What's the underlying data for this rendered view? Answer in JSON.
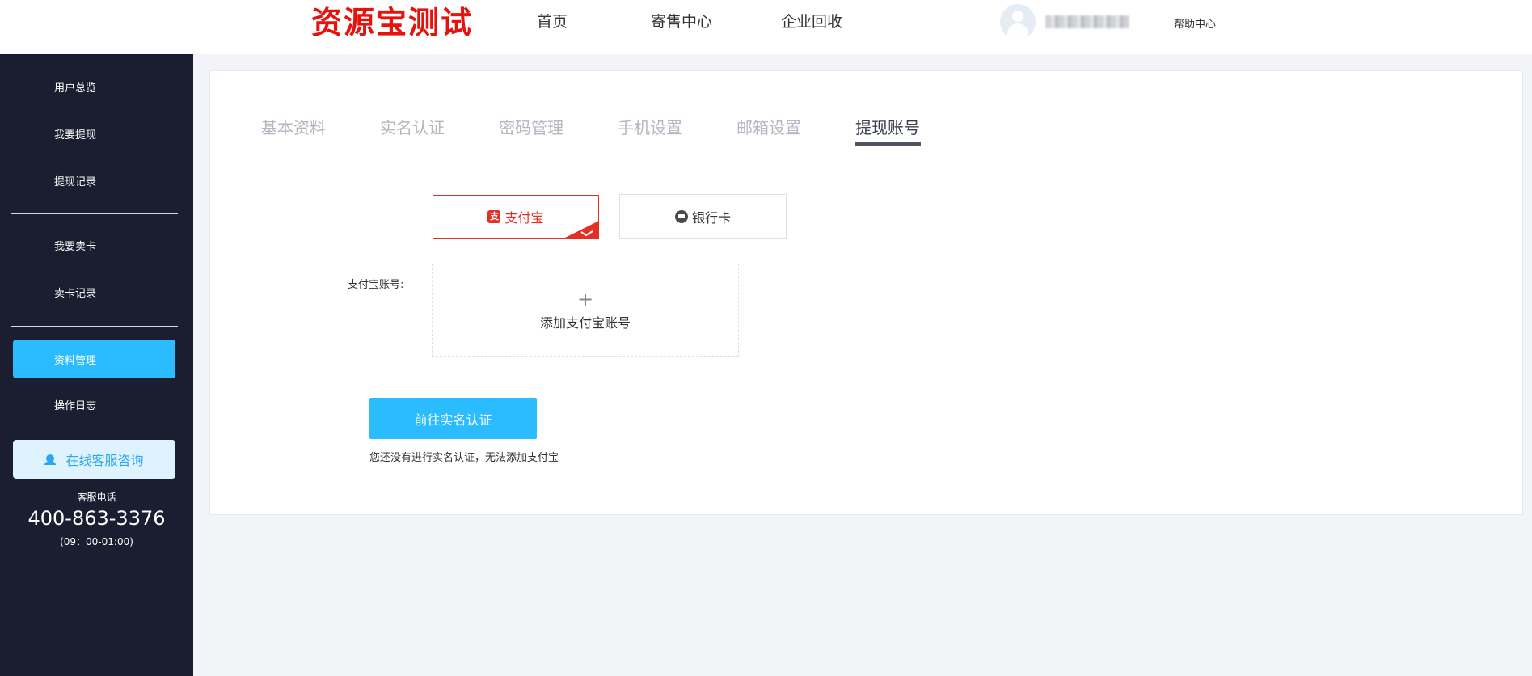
{
  "header": {
    "logo": "资源宝测试",
    "nav": [
      "首页",
      "寄售中心",
      "企业回收"
    ],
    "username": "user",
    "help": "帮助中心"
  },
  "sidebar": {
    "items": [
      "用户总览",
      "我要提现",
      "提现记录",
      "我要卖卡",
      "卖卡记录",
      "资料管理",
      "操作日志"
    ],
    "active_item": "资料管理",
    "service_button": "在线客服咨询",
    "phone_label": "客服电话",
    "phone": "400-863-3376",
    "hours": "(09：00-01:00)"
  },
  "main": {
    "tabs": [
      "基本资料",
      "实名认证",
      "密码管理",
      "手机设置",
      "邮箱设置",
      "提现账号"
    ],
    "active_tab": "提现账号",
    "pay_methods": {
      "alipay": "支付宝",
      "bank": "银行卡",
      "alipay_glyph": "支"
    },
    "selected_method": "支付宝",
    "field_label": "支付宝账号:",
    "add_plus": "+",
    "add_text": "添加支付宝账号",
    "verify_button": "前往实名认证",
    "hint": "您还没有进行实名认证，无法添加支付宝"
  },
  "colors": {
    "logo": "#e8120c",
    "sidebar_bg": "#1a1e30",
    "accent": "#2bbcff",
    "alipay_red": "#e43022"
  },
  "icons": [
    "avatar-icon",
    "headset-icon",
    "alipay-icon",
    "bank-card-icon",
    "check-corner-icon",
    "plus-icon"
  ]
}
